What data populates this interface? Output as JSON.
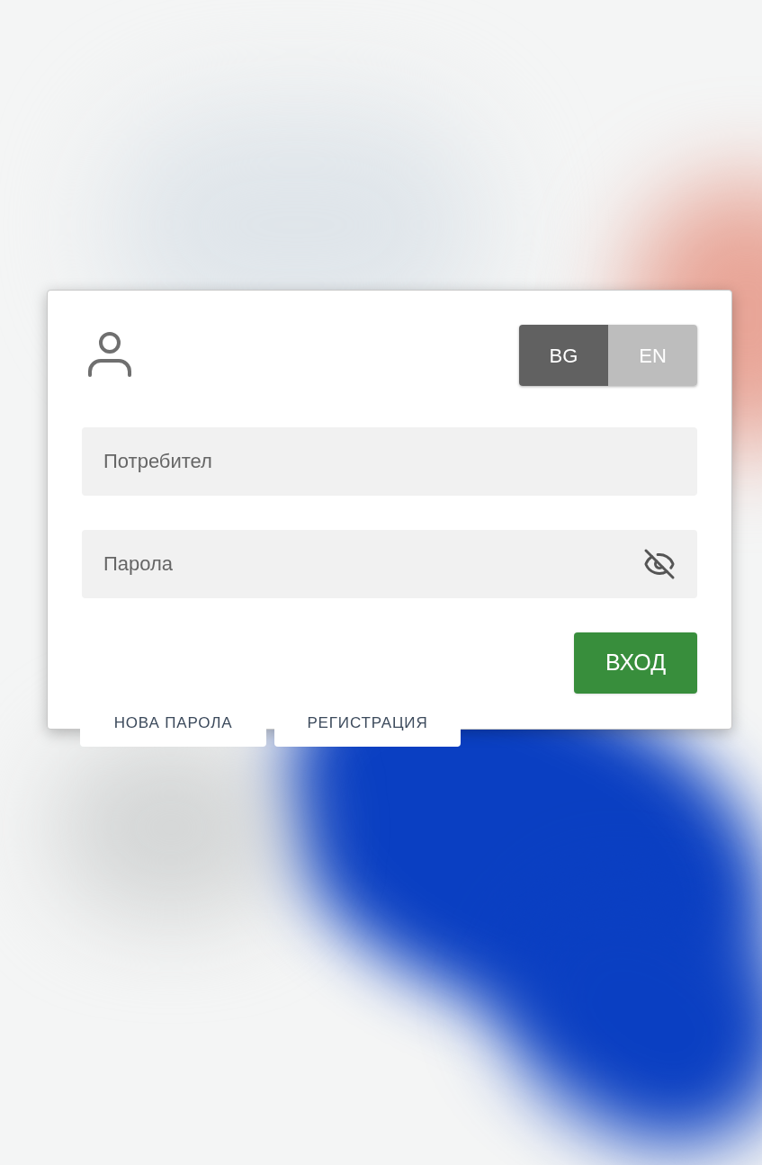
{
  "languages": [
    {
      "label": "BG",
      "selected": true
    },
    {
      "label": "EN",
      "selected": false
    }
  ],
  "username": {
    "placeholder": "Потребител"
  },
  "password": {
    "placeholder": "Парола"
  },
  "login_button": "ВХОД",
  "links": [
    "НОВА ПАРОЛА",
    "РЕГИСТРАЦИЯ"
  ]
}
